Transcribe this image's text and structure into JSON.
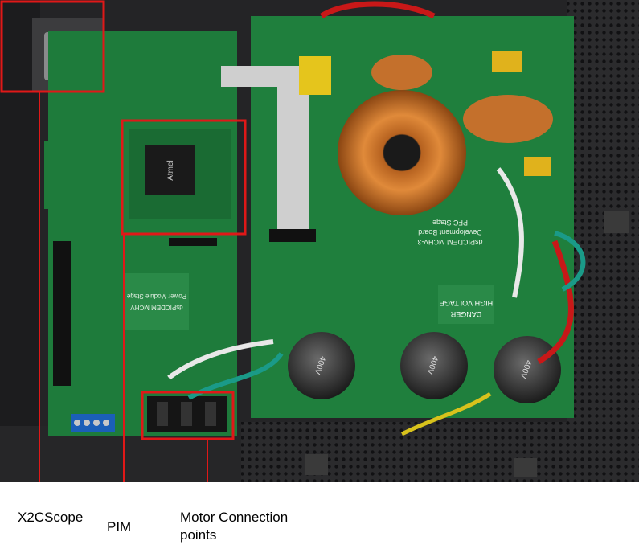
{
  "photo": {
    "subject": "motor-control-development-board-in-enclosure",
    "colors": {
      "enclosure": "#2a2a2c",
      "pcb": "#1f7a3a",
      "copper": "#c4702c",
      "annotation": "#e01818"
    }
  },
  "board_text": {
    "pim_chip": "Atmel",
    "pfc_title": "dsPICDEM MCHV-3",
    "pfc_sub": "Development Board",
    "pfc_stage": "PFC Stage",
    "danger": "DANGER",
    "high_voltage": "HIGH VOLTAGE",
    "pm_title": "dsPICDEM MCHV",
    "pm_sub": "Power Module Stage",
    "cap_label": "400V"
  },
  "annotations": {
    "x2cscope": "X2CScope",
    "pim": "PIM",
    "motor_line1": "Motor Connection",
    "motor_line2": "points"
  }
}
